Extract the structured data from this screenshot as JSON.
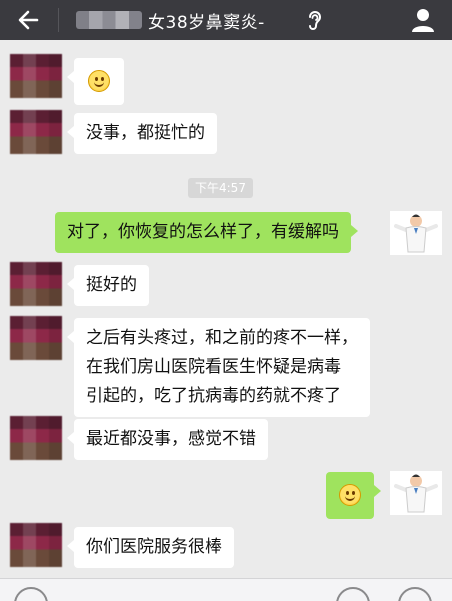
{
  "header": {
    "title": "女38岁鼻窦炎-",
    "back_icon": "arrow-left-icon",
    "ear_icon": "ear-icon",
    "profile_icon": "person-icon"
  },
  "messages": [
    {
      "side": "left",
      "type": "emoji",
      "emoji": "smile-emoji"
    },
    {
      "side": "left",
      "type": "text",
      "text": "没事，都挺忙的"
    },
    {
      "side": "right",
      "type": "text",
      "text": "对了，你恢复的怎么样了，有缓解吗"
    },
    {
      "side": "left",
      "type": "text",
      "text": "挺好的"
    },
    {
      "side": "left",
      "type": "text",
      "lines": [
        "之后有头疼过，和之前的疼不一样，",
        "在我们房山医院看医生怀疑是病毒",
        "引起的，吃了抗病毒的药就不疼了"
      ]
    },
    {
      "side": "left",
      "type": "text",
      "text": "最近都没事，感觉不错"
    },
    {
      "side": "right",
      "type": "emoji",
      "emoji": "smile-emoji"
    },
    {
      "side": "left",
      "type": "text",
      "text": "你们医院服务很棒"
    }
  ],
  "timestamp": "下午4:57",
  "colors": {
    "header_bg": "#3a3a3f",
    "chat_bg": "#ebebeb",
    "sent_bubble": "#9fe35e",
    "received_bubble": "#ffffff"
  }
}
